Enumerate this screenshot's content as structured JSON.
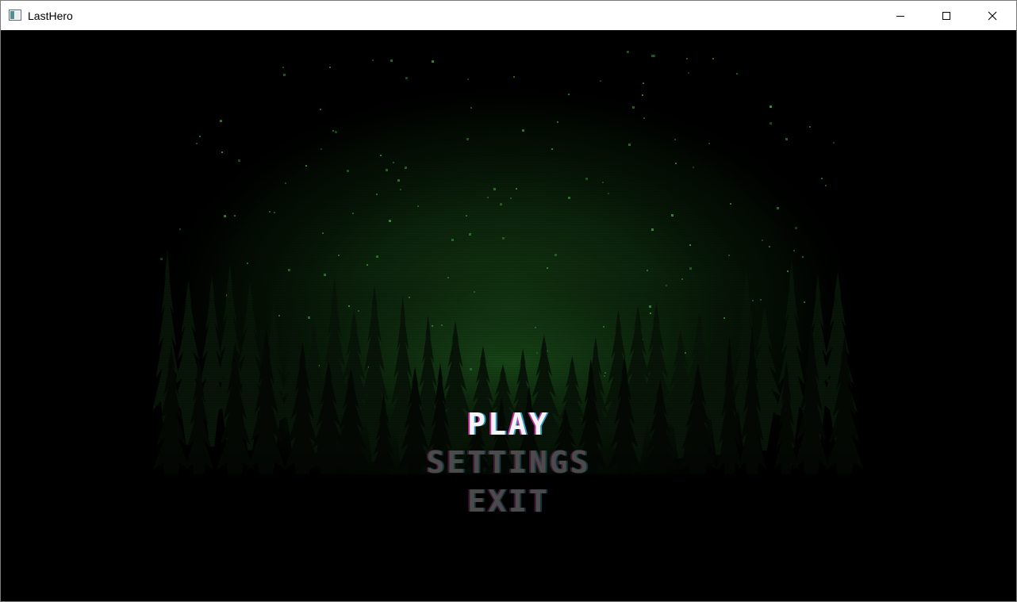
{
  "window": {
    "title": "LastHero",
    "icon": "app-window-icon",
    "controls": {
      "minimize": "minimize-icon",
      "maximize": "maximize-icon",
      "close": "close-icon"
    }
  },
  "menu": {
    "items": [
      {
        "label": "PLAY",
        "state": "selected"
      },
      {
        "label": "SETTINGS",
        "state": "normal"
      },
      {
        "label": "EXIT",
        "state": "normal"
      }
    ]
  },
  "colors": {
    "background": "#000000",
    "glow": "#1a5a1a",
    "stars": "#3fa03f",
    "selected_text": "#f4f4f4",
    "unselected_text": "#4b4b4b"
  }
}
